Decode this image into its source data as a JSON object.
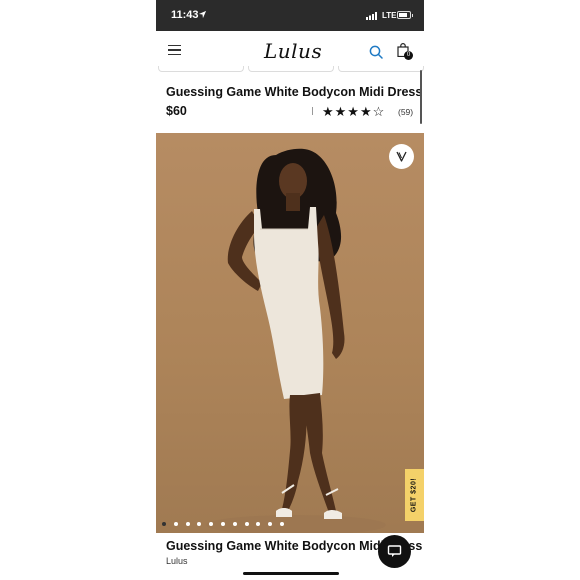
{
  "status_bar": {
    "time": "11:43",
    "network": "LTE"
  },
  "nav": {
    "logo": "Lulus",
    "cart_count": "0"
  },
  "product": {
    "title": "Guessing Game White Bodycon Midi Dress",
    "price": "$60",
    "rating": 4.5,
    "stars": "★★★★☆",
    "review_count": "(59)",
    "brand": "Lulus",
    "bottom_title": "Guessing Game White Bodycon Midi Dress"
  },
  "gallery": {
    "image_count": 11,
    "active_index": 0
  },
  "promo": {
    "label": "GET $20!"
  },
  "icons": [
    "navigation-arrow-icon",
    "signal-icon",
    "battery-icon",
    "menu-icon",
    "search-icon",
    "shopping-bag-icon",
    "heart-icon",
    "chat-icon"
  ],
  "colors": {
    "accent_promo": "#f4d169",
    "photo_bg": "#b08760",
    "search_blue": "#1f7ac4"
  }
}
